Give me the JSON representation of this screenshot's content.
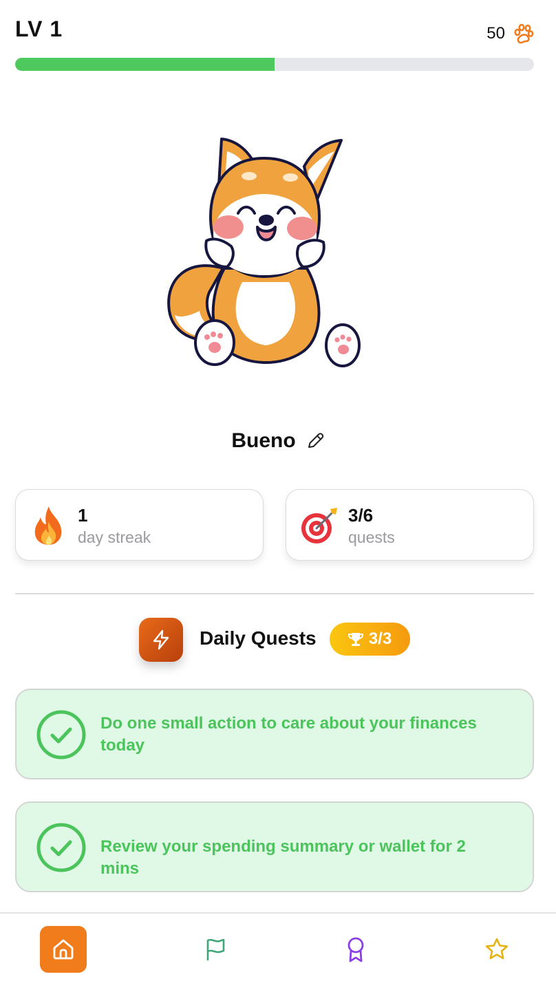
{
  "header": {
    "level_label": "LV 1",
    "coins": "50",
    "xp_progress_fraction": 0.5
  },
  "pet": {
    "name": "Bueno"
  },
  "stats": {
    "streak_value": "1",
    "streak_label": "day streak",
    "quests_value": "3/6",
    "quests_label": "quests"
  },
  "daily_quests": {
    "title": "Daily Quests",
    "badge_count": "3/3",
    "items": [
      {
        "text": "Do one small action to care about your finances today",
        "completed": true
      },
      {
        "text": "Review your spending summary or wallet for 2 mins",
        "completed": true
      }
    ]
  },
  "nav": {
    "items": [
      "home-icon",
      "flag-icon",
      "award-icon",
      "star-icon"
    ],
    "active": "home-icon"
  },
  "colors": {
    "accent_orange": "#f07c1c",
    "progress_green": "#4ec95e",
    "quest_green_text": "#4cc45c",
    "quest_bg": "#e0f8e6",
    "badge_gold": "#fbc60f"
  }
}
